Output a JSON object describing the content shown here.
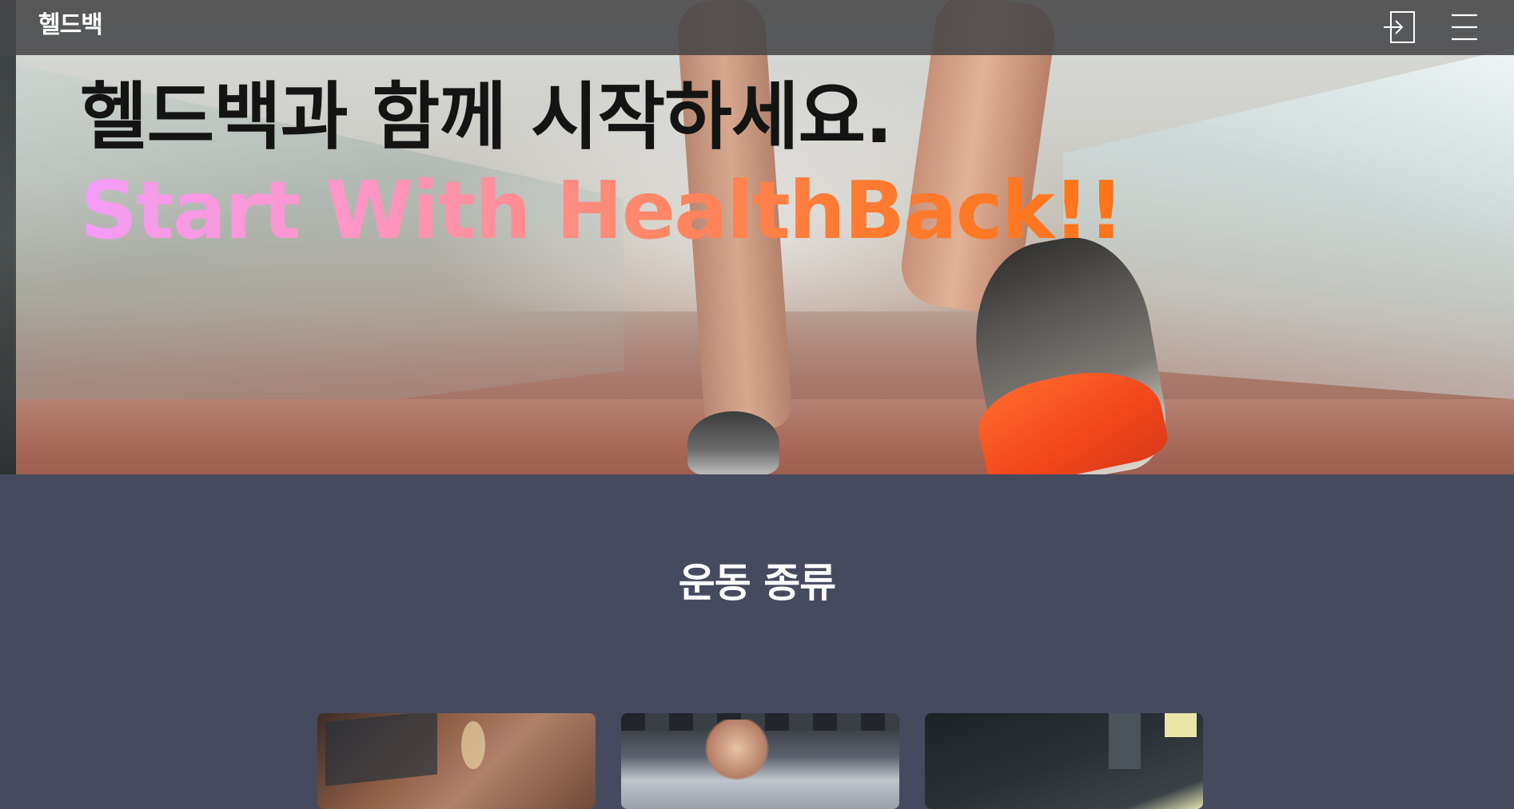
{
  "nav": {
    "brand": "헬드백",
    "login_icon": "login-icon",
    "menu_icon": "hamburger-menu-icon"
  },
  "hero": {
    "title_ko": "헬드백과 함께 시작하세요.",
    "title_en": "Start With HealthBack!!",
    "gradient_colors": [
      "#f39cf7",
      "#ff95c2",
      "#ff8a78",
      "#ff7c36",
      "#ff7416"
    ]
  },
  "section": {
    "title": "운동 종류"
  },
  "cards": [
    {
      "name": "exercise-card-1"
    },
    {
      "name": "exercise-card-2"
    },
    {
      "name": "exercise-card-3"
    }
  ],
  "colors": {
    "page_background": "#464a5f",
    "nav_background": "#464648",
    "text_light": "#ffffff",
    "text_dark": "#141414"
  }
}
